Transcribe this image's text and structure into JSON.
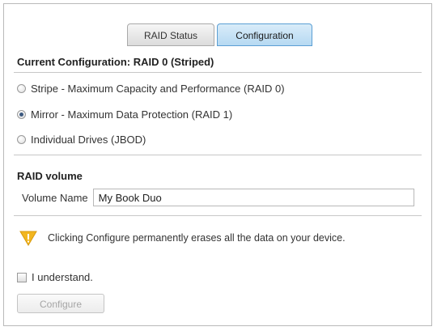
{
  "tabs": [
    {
      "label": "RAID Status",
      "active": false
    },
    {
      "label": "Configuration",
      "active": true
    }
  ],
  "current_configuration": {
    "label": "Current Configuration:",
    "value": "RAID 0 (Striped)"
  },
  "options": [
    {
      "label": "Stripe - Maximum Capacity and Performance (RAID 0)",
      "checked": false
    },
    {
      "label": "Mirror - Maximum Data Protection (RAID 1)",
      "checked": true
    },
    {
      "label": "Individual Drives (JBOD)",
      "checked": false
    }
  ],
  "raid_volume": {
    "title": "RAID volume",
    "name_label": "Volume Name",
    "name_value": "My Book Duo"
  },
  "warning": {
    "icon": "warning-triangle-icon",
    "text": "Clicking Configure permanently erases all the data on your device."
  },
  "understand": {
    "label": "I understand.",
    "checked": false
  },
  "configure_button": {
    "label": "Configure",
    "disabled": true
  },
  "colors": {
    "active_tab": "#b6d9f2",
    "warning": "#f2b61f",
    "selected_radio": "#3d5a80"
  }
}
